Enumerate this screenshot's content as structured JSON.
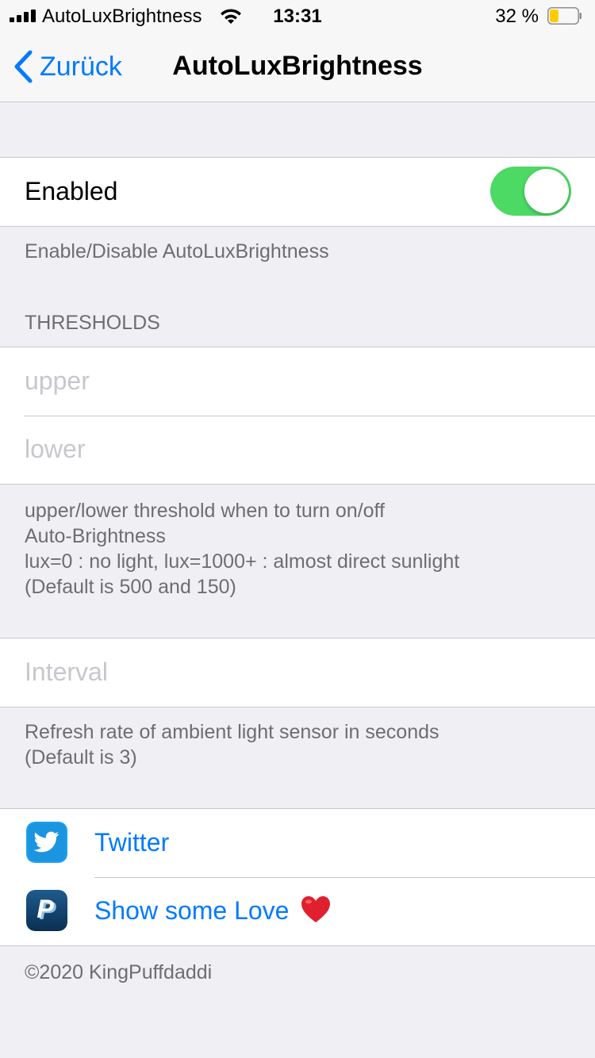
{
  "status_bar": {
    "carrier": "AutoLuxBrightness",
    "time": "13:31",
    "battery_percent": "32 %",
    "battery_level": 0.32,
    "icons": [
      "signal-icon",
      "wifi-icon",
      "battery-icon"
    ]
  },
  "nav": {
    "back_label": "Zurück",
    "title": "AutoLuxBrightness",
    "accent_color": "#007aff"
  },
  "enabled_section": {
    "label": "Enabled",
    "toggle_on": true,
    "toggle_color": "#4cd964",
    "footer": "Enable/Disable AutoLuxBrightness"
  },
  "thresholds_section": {
    "header": "THRESHOLDS",
    "upper_placeholder": "upper",
    "lower_placeholder": "lower",
    "footer_lines": [
      "upper/lower threshold when to turn on/off",
      "Auto-Brightness",
      "lux=0 : no light, lux=1000+ : almost direct sunlight",
      "(Default is 500 and 150)"
    ]
  },
  "interval_section": {
    "placeholder": "Interval",
    "footer_lines": [
      "Refresh rate of ambient light sensor in seconds",
      "(Default is 3)"
    ]
  },
  "links_section": {
    "twitter_label": "Twitter",
    "twitter_icon": "twitter-icon",
    "paypal_label": "Show some Love",
    "paypal_icon": "paypal-icon",
    "heart_icon": "heart-icon",
    "footer": "©2020 KingPuffdaddi"
  }
}
